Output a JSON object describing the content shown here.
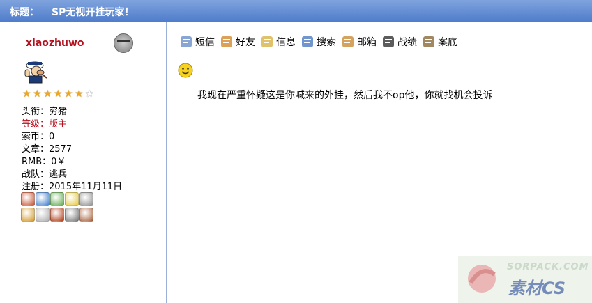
{
  "title_bar": {
    "label": "标题：",
    "title": "SP无视开挂玩家！"
  },
  "user": {
    "name": "xiaozhuwo",
    "rating": {
      "filled": 6,
      "total": 7
    },
    "fields": [
      {
        "text": "头衔：穷猪",
        "highlight": false
      },
      {
        "text": "等级：版主",
        "highlight": true
      },
      {
        "text": "索币：0",
        "highlight": false
      },
      {
        "text": "文章：2577",
        "highlight": false
      },
      {
        "text": "RMB：0￥",
        "highlight": false
      },
      {
        "text": "战队：逃兵",
        "highlight": false
      },
      {
        "text": "注册：2015年11月11日",
        "highlight": false
      }
    ],
    "badges_row1": [
      "#c74d2b",
      "#3f7fcf",
      "#5da84a",
      "#e6c93a",
      "#8d8d8d"
    ],
    "badges_row2": [
      "#d49a2a",
      "#b0b0b0",
      "#b03a14",
      "#7a7a7a",
      "#a8603a"
    ]
  },
  "toolbar": [
    {
      "label": "短信",
      "icon": "sms-icon"
    },
    {
      "label": "好友",
      "icon": "friends-icon"
    },
    {
      "label": "信息",
      "icon": "info-icon"
    },
    {
      "label": "搜索",
      "icon": "search-icon"
    },
    {
      "label": "邮箱",
      "icon": "mail-icon"
    },
    {
      "label": "战绩",
      "icon": "stats-icon"
    },
    {
      "label": "案底",
      "icon": "record-icon"
    }
  ],
  "post": {
    "text": "我现在严重怀疑这是你喊来的外挂，然后我不op他，你就找机会投诉"
  },
  "watermark": {
    "url": "SORPACK.COM",
    "name": "素材CS"
  },
  "colors": {
    "title_bar": "#5b86d1",
    "username": "#b4101e",
    "divider": "#9ab0d8"
  }
}
